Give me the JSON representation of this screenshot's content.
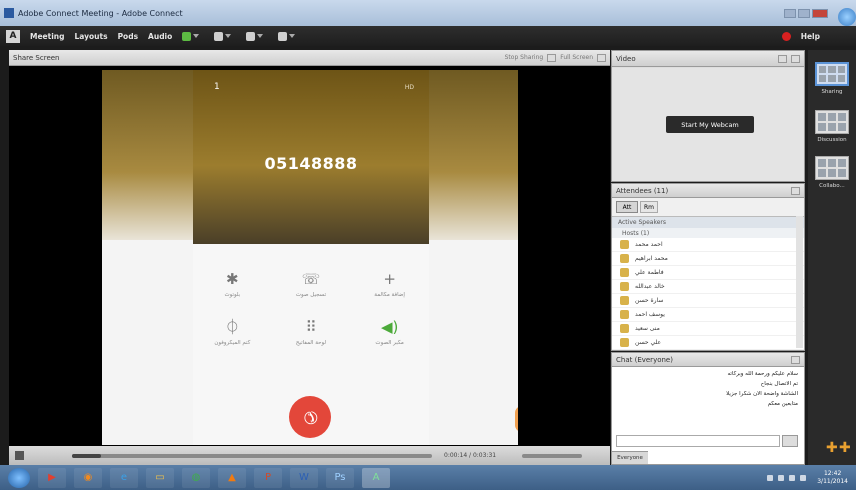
{
  "window": {
    "title": "Adobe Connect Meeting - Adobe Connect"
  },
  "menubar": {
    "logo_label": "A",
    "items": [
      "Meeting",
      "Layouts",
      "Pods",
      "Audio"
    ],
    "help_label": "Help"
  },
  "share_pod": {
    "title": "Share Screen",
    "header_controls": [
      "Stop Sharing",
      "Full Screen"
    ],
    "phone": {
      "dialed_number": "05148888",
      "sim_indicator": "1",
      "corner_text": "HD",
      "keys": [
        {
          "icon": "bluetooth-icon",
          "glyph": "✱",
          "label": "بلوتوث",
          "active": false
        },
        {
          "icon": "record-icon",
          "glyph": "☏",
          "label": "تسجيل صوت",
          "active": false
        },
        {
          "icon": "add-call-icon",
          "glyph": "+",
          "label": "إضافة مكالمة",
          "active": false
        },
        {
          "icon": "mute-icon",
          "glyph": "⏀",
          "label": "كتم الميكروفون",
          "active": false
        },
        {
          "icon": "keypad-icon",
          "glyph": "⠿",
          "label": "لوحة المفاتيح",
          "active": false
        },
        {
          "icon": "speaker-icon",
          "glyph": "◀)",
          "label": "مكبر الصوت",
          "active": true
        }
      ],
      "end_call_glyph": "✆"
    },
    "player": {
      "progress": 0.08,
      "time_text": "0:00:14 / 0:03:31"
    }
  },
  "video_pod": {
    "title": "Video",
    "start_button": "Start My Webcam"
  },
  "attendees_pod": {
    "title": "Attendees (11)",
    "toolbar_labels": [
      "Att",
      "Rm"
    ],
    "section": "Active Speakers",
    "subsection": "Hosts (1)",
    "attendees": [
      "احمد محمد",
      "محمد ابراهيم",
      "فاطمة علي",
      "خالد عبدالله",
      "سارة حسن",
      "يوسف احمد",
      "منى سعيد",
      "علي حسن"
    ]
  },
  "chat_pod": {
    "title": "Chat (Everyone)",
    "messages": [
      "سلام عليكم ورحمة الله وبركاته",
      "تم الاتصال بنجاح",
      "الشاشة واضحة الآن شكرا جزيلا",
      "متابعين معكم"
    ],
    "tab_label": "Everyone"
  },
  "layouts_bar": {
    "items": [
      "Sharing",
      "Discussion",
      "Collabo..."
    ]
  },
  "taskbar": {
    "apps": [
      {
        "icon": "media-player-icon",
        "glyph": "▶",
        "color": "#e04030"
      },
      {
        "icon": "firefox-icon",
        "glyph": "◉",
        "color": "#f08a20"
      },
      {
        "icon": "ie-icon",
        "glyph": "e",
        "color": "#3aa0e8"
      },
      {
        "icon": "folder-icon",
        "glyph": "▭",
        "color": "#f2c24a"
      },
      {
        "icon": "chrome-icon",
        "glyph": "◍",
        "color": "#3fae4a"
      },
      {
        "icon": "vlc-icon",
        "glyph": "▲",
        "color": "#f07a10"
      },
      {
        "icon": "powerpoint-icon",
        "glyph": "P",
        "color": "#d04a2a"
      },
      {
        "icon": "word-icon",
        "glyph": "W",
        "color": "#2b5fb4"
      },
      {
        "icon": "photoshop-icon",
        "glyph": "Ps",
        "color": "#1b3f66"
      },
      {
        "icon": "adobe-connect-icon",
        "glyph": "A",
        "color": "#2e7d46"
      }
    ],
    "clock_time": "12:42",
    "clock_date": "3/11/2014"
  }
}
